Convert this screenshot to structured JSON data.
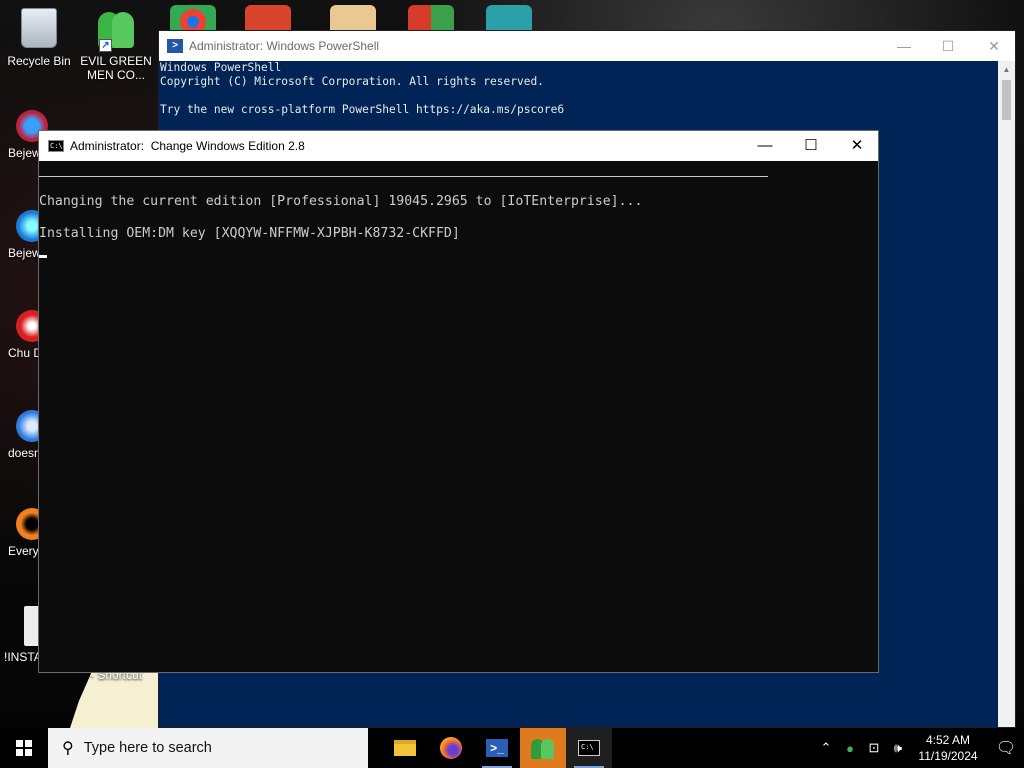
{
  "desktop": {
    "icons": [
      {
        "label": "Recycle Bin"
      },
      {
        "label": "EVIL GREEN MEN CO..."
      }
    ],
    "partial_labels": [
      "Bejew Del",
      "Bejew Del",
      "Chu Del",
      "doesn",
      "Every",
      "!INSTA"
    ],
    "shortcut_label": "- Shortcut"
  },
  "powershell": {
    "title": "Administrator: Windows PowerShell",
    "lines": [
      "Windows PowerShell",
      "Copyright (C) Microsoft Corporation. All rights reserved.",
      "",
      "Try the new cross-platform PowerShell https://aka.ms/pscore6"
    ],
    "bg_color": "#012456"
  },
  "cmd": {
    "title": "Administrator:  Change Windows Edition 2.8",
    "icon_text": "C:\\",
    "lines": [
      "Changing the current edition [Professional] 19045.2965 to [IoTEnterprise]...",
      "",
      "Installing OEM:DM key [XQQYW-NFFMW-XJPBH-K8732-CKFFD]"
    ]
  },
  "window_controls": {
    "minimize": "—",
    "maximize": "☐",
    "close": "✕"
  },
  "taskbar": {
    "search_placeholder": "Type here to search",
    "apps": [
      "file-explorer",
      "firefox",
      "powershell",
      "evil-green-men",
      "command-prompt"
    ],
    "tray_icons": [
      "chevron-up",
      "people",
      "network",
      "volume"
    ],
    "time": "4:52 AM",
    "date": "11/19/2024",
    "accent": "#e07a1e"
  }
}
